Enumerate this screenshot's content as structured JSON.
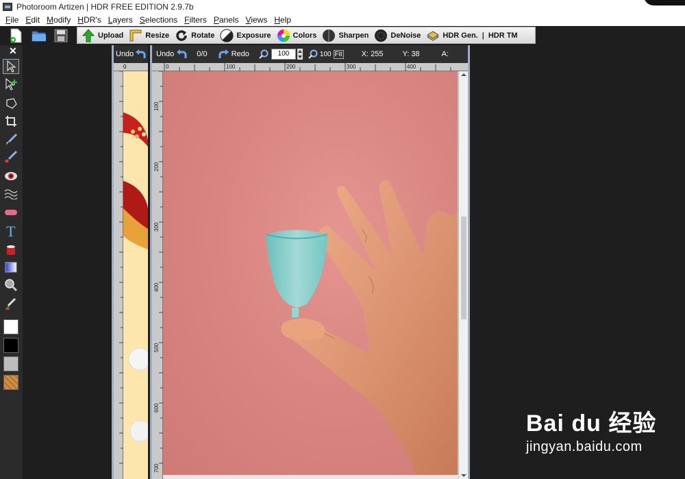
{
  "window": {
    "title": "Photoroom Artizen | HDR FREE EDITION 2.9.7b"
  },
  "menu": [
    "File",
    "Edit",
    "Modify",
    "HDR's",
    "Layers",
    "Selections",
    "Filters",
    "Panels",
    "Views",
    "Help"
  ],
  "toolbar": {
    "upload": "Upload",
    "resize": "Resize",
    "rotate": "Rotate",
    "exposure": "Exposure",
    "colors": "Colors",
    "sharpen": "Sharpen",
    "denoise": "DeNoise",
    "hdr_gen": "HDR Gen.",
    "separator": "|",
    "hdr_tm": "HDR TM"
  },
  "layer_panel": {
    "undo": "Undo",
    "ruler_zero": "0"
  },
  "canvas": {
    "undo": "Undo",
    "history": "0/0",
    "redo": "Redo",
    "zoom_value": "100",
    "zoom_preset": "100",
    "fit_label": "Fit",
    "x_readout": "X: 255",
    "y_readout": "Y: 38",
    "a_readout": "A:"
  },
  "rulers": {
    "top": [
      "0",
      "100",
      "200",
      "300",
      "400"
    ],
    "left": [
      "100",
      "200",
      "300",
      "400",
      "500",
      "600",
      "700"
    ]
  },
  "watermark": {
    "logo": "Bai du 经验",
    "url": "jingyan.baidu.com"
  },
  "colors": {
    "accent_blue": "#9ab0d0",
    "photo_pink": "#d88480",
    "cup_teal": "#7fd3cf"
  }
}
